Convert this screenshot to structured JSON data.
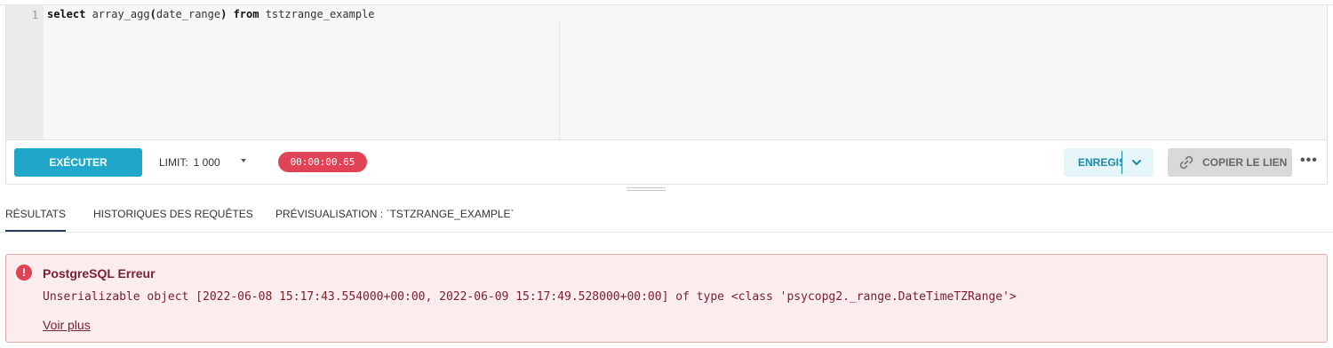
{
  "editor": {
    "line_number": "1",
    "code": {
      "kw_select": "select",
      "part1": " array_agg",
      "paren_open": "(",
      "part2": "date_range",
      "paren_close": ")",
      "kw_from": "from",
      "part3": " tstzrange_example"
    }
  },
  "toolbar": {
    "run_label": "EXÉCUTER",
    "limit_label": "LIMIT:",
    "limit_value": "1 000",
    "timer": "00:00:00.65",
    "save_label": "ENREGISTRER",
    "copy_label": "COPIER LE LIEN",
    "more_label": "•••"
  },
  "tabs": [
    {
      "label": "RÉSULTATS",
      "active": true
    },
    {
      "label": "HISTORIQUES DES REQUÊTES",
      "active": false
    },
    {
      "label": "PRÉVISUALISATION : `TSTZRANGE_EXAMPLE`",
      "active": false
    }
  ],
  "error": {
    "icon": "!",
    "title": "PostgreSQL Erreur",
    "message": "Unserializable object [2022-06-08 15:17:43.554000+00:00, 2022-06-09 15:17:49.528000+00:00] of type <class 'psycopg2._range.DateTimeTZRange'>",
    "link": "Voir plus"
  },
  "icons": {
    "save_chevron": "chevron-down-icon",
    "copy": "link-icon",
    "more": "more-horizontal-icon",
    "error": "alert-circle-icon"
  },
  "colors": {
    "primary": "#20a7c9",
    "danger": "#e04355",
    "error_bg": "#fbecee",
    "error_text": "#7a2130",
    "active_tab": "#2b3a55"
  }
}
